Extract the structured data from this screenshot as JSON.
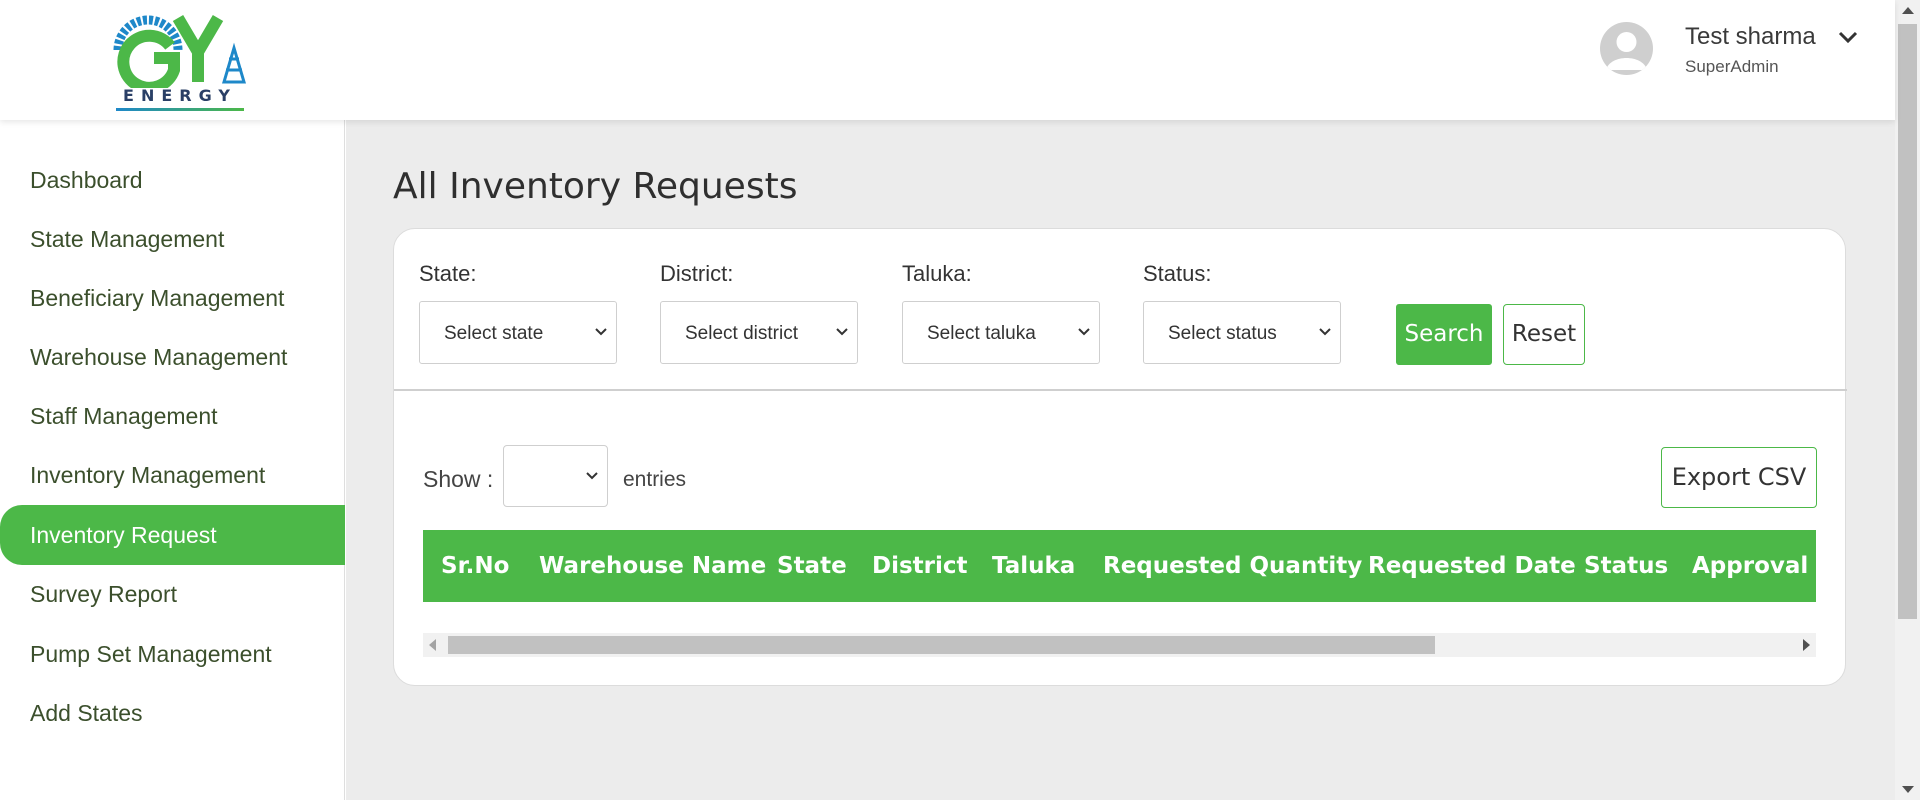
{
  "header": {
    "logo_text": "ENERGY",
    "logo_mark": "GY",
    "user_name": "Test sharma",
    "user_role": "SuperAdmin"
  },
  "sidebar": {
    "items": [
      {
        "label": "Dashboard",
        "active": false
      },
      {
        "label": "State Management",
        "active": false
      },
      {
        "label": "Beneficiary Management",
        "active": false
      },
      {
        "label": "Warehouse Management",
        "active": false
      },
      {
        "label": "Staff Management",
        "active": false
      },
      {
        "label": "Inventory Management",
        "active": false
      },
      {
        "label": "Inventory Request",
        "active": true
      },
      {
        "label": "Survey Report",
        "active": false
      },
      {
        "label": "Pump Set Management",
        "active": false
      },
      {
        "label": "Add States",
        "active": false
      }
    ]
  },
  "main": {
    "title": "All Inventory Requests",
    "filters": {
      "state_label": "State:",
      "state_value": "Select state",
      "district_label": "District:",
      "district_value": "Select district",
      "taluka_label": "Taluka:",
      "taluka_value": "Select taluka",
      "status_label": "Status:",
      "status_value": "Select status",
      "search_label": "Search",
      "reset_label": "Reset"
    },
    "show_label": "Show :",
    "entries_value": "",
    "entries_label": "entries",
    "export_label": "Export CSV",
    "table": {
      "columns": [
        "Sr.No",
        "Warehouse Name",
        "State",
        "District",
        "Taluka",
        "Requested Quantity",
        "Requested Date",
        "Status",
        "Approval S"
      ],
      "rows": []
    }
  },
  "colors": {
    "accent": "#4cb848",
    "main_bg": "#ececec",
    "sidebar_text": "#3b4f2c"
  }
}
